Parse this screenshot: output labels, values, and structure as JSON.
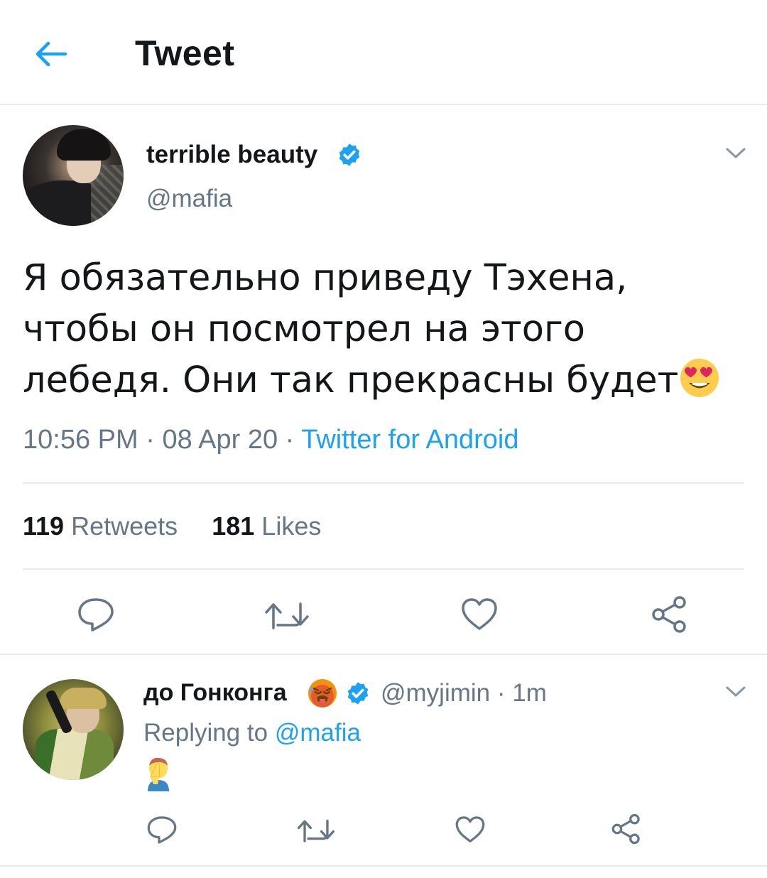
{
  "header": {
    "title": "Tweet",
    "back_icon": "arrow-left-icon"
  },
  "colors": {
    "accent": "#1da1f2",
    "text": "#14171a",
    "secondary": "#657786",
    "divider": "#e6ecf0"
  },
  "tweet": {
    "author_name": "terrible beauty",
    "handle": "@mafia",
    "verified": true,
    "text": "Я обязательно приведу Тэхена, чтобы он посмотрел на этого лебедя. Они так прекрасны будет",
    "text_emoji": "heart-eyes-emoji",
    "time": "10:56 PM",
    "date": "08 Apr 20",
    "separator": " · ",
    "source": "Twitter for Android",
    "retweets_count": "119",
    "retweets_label": "Retweets",
    "likes_count": "181",
    "likes_label": "Likes"
  },
  "reply": {
    "author_name": "до Гонконга",
    "name_emoji": "hot-face-emoji",
    "verified": true,
    "handle": "@myjimin",
    "time": "1m",
    "replying_prefix": "Replying to",
    "replying_to": "@mafia",
    "text_emoji": "face-palm-emoji"
  },
  "actions": [
    "reply-icon",
    "retweet-icon",
    "like-icon",
    "share-icon"
  ]
}
